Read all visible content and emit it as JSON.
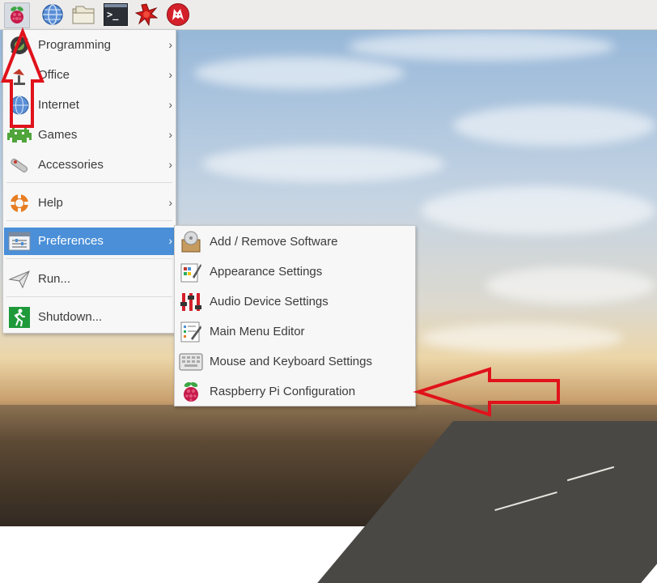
{
  "taskbar": {
    "icons": [
      {
        "name": "raspberry-pi-menu-icon"
      },
      {
        "name": "web-browser-icon"
      },
      {
        "name": "file-manager-icon"
      },
      {
        "name": "terminal-icon"
      },
      {
        "name": "mathematica-icon"
      },
      {
        "name": "wolfram-icon"
      }
    ],
    "terminal_glyph": ">_"
  },
  "main_menu": {
    "items": [
      {
        "label": "Programming",
        "icon": "programming-icon",
        "has_submenu": true
      },
      {
        "label": "Office",
        "icon": "office-icon",
        "has_submenu": true
      },
      {
        "label": "Internet",
        "icon": "internet-icon",
        "has_submenu": true
      },
      {
        "label": "Games",
        "icon": "games-icon",
        "has_submenu": true
      },
      {
        "label": "Accessories",
        "icon": "accessories-icon",
        "has_submenu": true
      },
      {
        "label": "Help",
        "icon": "help-icon",
        "has_submenu": true
      },
      {
        "label": "Preferences",
        "icon": "preferences-icon",
        "has_submenu": true,
        "selected": true
      },
      {
        "label": "Run...",
        "icon": "run-icon",
        "has_submenu": false
      },
      {
        "label": "Shutdown...",
        "icon": "shutdown-icon",
        "has_submenu": false
      }
    ],
    "chevron": "›"
  },
  "preferences_submenu": {
    "items": [
      {
        "label": "Add / Remove Software",
        "icon": "add-remove-software-icon"
      },
      {
        "label": "Appearance Settings",
        "icon": "appearance-settings-icon"
      },
      {
        "label": "Audio Device Settings",
        "icon": "audio-device-settings-icon"
      },
      {
        "label": "Main Menu Editor",
        "icon": "main-menu-editor-icon"
      },
      {
        "label": "Mouse and Keyboard Settings",
        "icon": "mouse-keyboard-settings-icon"
      },
      {
        "label": "Raspberry Pi Configuration",
        "icon": "raspberry-pi-configuration-icon"
      }
    ]
  },
  "colors": {
    "selection": "#4a8fd8",
    "annotation_arrow": "#e0121b",
    "panel": "#edecea",
    "menu_bg": "#f7f7f7"
  }
}
